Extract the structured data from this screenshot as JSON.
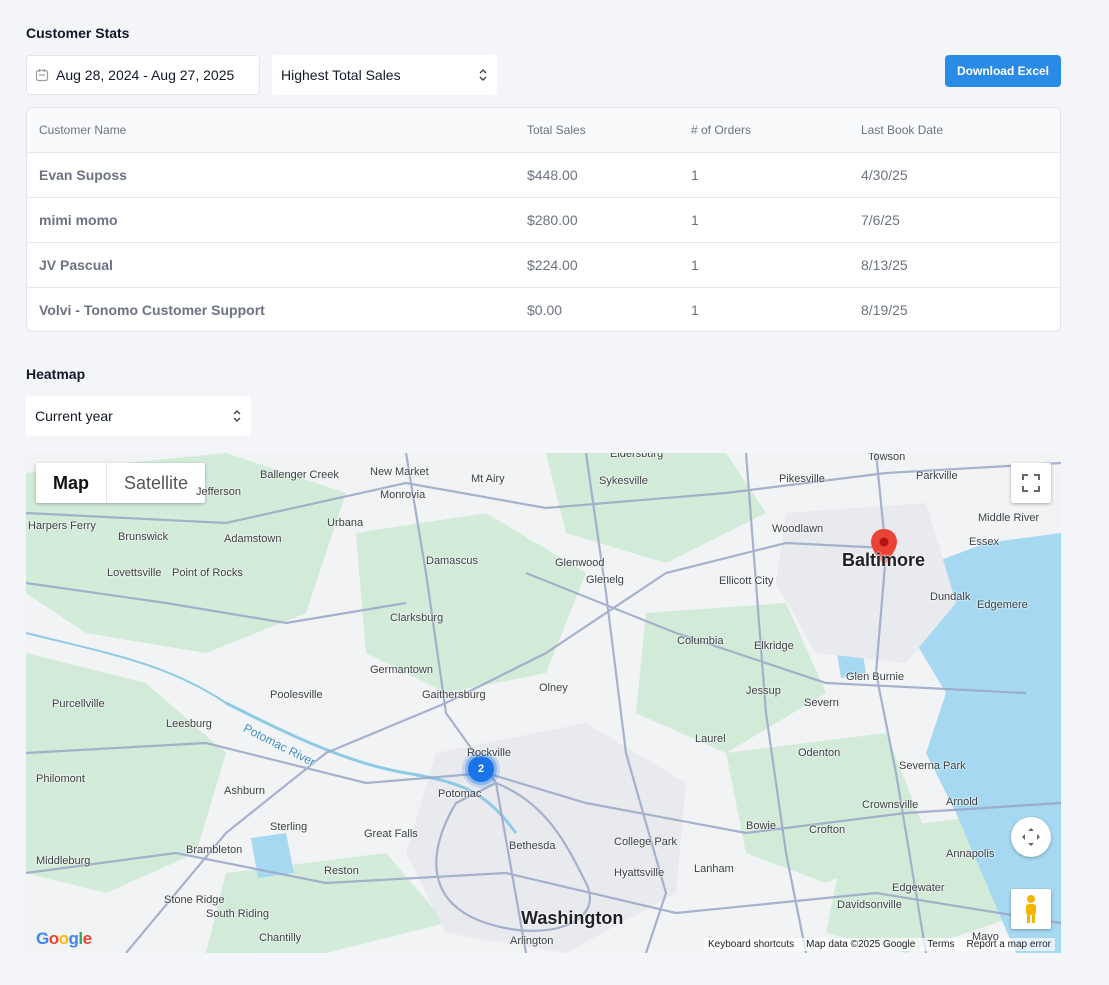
{
  "stats": {
    "title": "Customer Stats",
    "date_range": "Aug 28, 2024 - Aug 27, 2025",
    "sort_select": "Highest Total Sales",
    "download_label": "Download Excel"
  },
  "table": {
    "headers": [
      "Customer Name",
      "Total Sales",
      "# of Orders",
      "Last Book Date"
    ],
    "rows": [
      {
        "name": "Evan Suposs",
        "sales": "$448.00",
        "orders": "1",
        "date": "4/30/25"
      },
      {
        "name": "mimi momo",
        "sales": "$280.00",
        "orders": "1",
        "date": "7/6/25"
      },
      {
        "name": "JV Pascual",
        "sales": "$224.00",
        "orders": "1",
        "date": "8/13/25"
      },
      {
        "name": "Volvi - Tonomo Customer Support",
        "sales": "$0.00",
        "orders": "1",
        "date": "8/19/25"
      }
    ]
  },
  "heatmap": {
    "title": "Heatmap",
    "period_select": "Current year",
    "map_type": {
      "map": "Map",
      "satellite": "Satellite"
    },
    "cluster_count": "2",
    "footer": {
      "shortcuts": "Keyboard shortcuts",
      "data": "Map data ©2025 Google",
      "terms": "Terms",
      "report": "Report a map error"
    },
    "logo": "Google",
    "places": [
      "Eldersburg",
      "Towson",
      "New Market",
      "Mt Airy",
      "Sykesville",
      "Pikesville",
      "Parkville",
      "Ballenger Creek",
      "Jefferson",
      "Monrovia",
      "Urbana",
      "Harpers Ferry",
      "Brunswick",
      "Adamstown",
      "Woodlawn",
      "Middle River",
      "Baltimore",
      "Essex",
      "Lovettsville",
      "Point of Rocks",
      "Damascus",
      "Glenwood",
      "Glenelg",
      "Ellicott City",
      "Dundalk",
      "Edgemere",
      "Clarksburg",
      "Columbia",
      "Elkridge",
      "Germantown",
      "Olney",
      "Jessup",
      "Glen Burnie",
      "Poolesville",
      "Gaithersburg",
      "Severn",
      "Purcellville",
      "Leesburg",
      "Laurel",
      "Odenton",
      "Rockville",
      "Potomac River",
      "Severna Park",
      "Philomont",
      "Potomac",
      "Ashburn",
      "Crownsville",
      "Arnold",
      "Sterling",
      "Great Falls",
      "Bethesda",
      "College Park",
      "Bowie",
      "Crofton",
      "Brambleton",
      "Annapolis",
      "Middleburg",
      "Reston",
      "Hyattsville",
      "Lanham",
      "Edgewater",
      "Stone Ridge",
      "South Riding",
      "Davidsonville",
      "Washington",
      "Chantilly",
      "Arlington",
      "Mayo"
    ]
  },
  "colors": {
    "primary": "#2a8be6",
    "cluster": "#1a73e8",
    "pin": "#ea4335"
  }
}
